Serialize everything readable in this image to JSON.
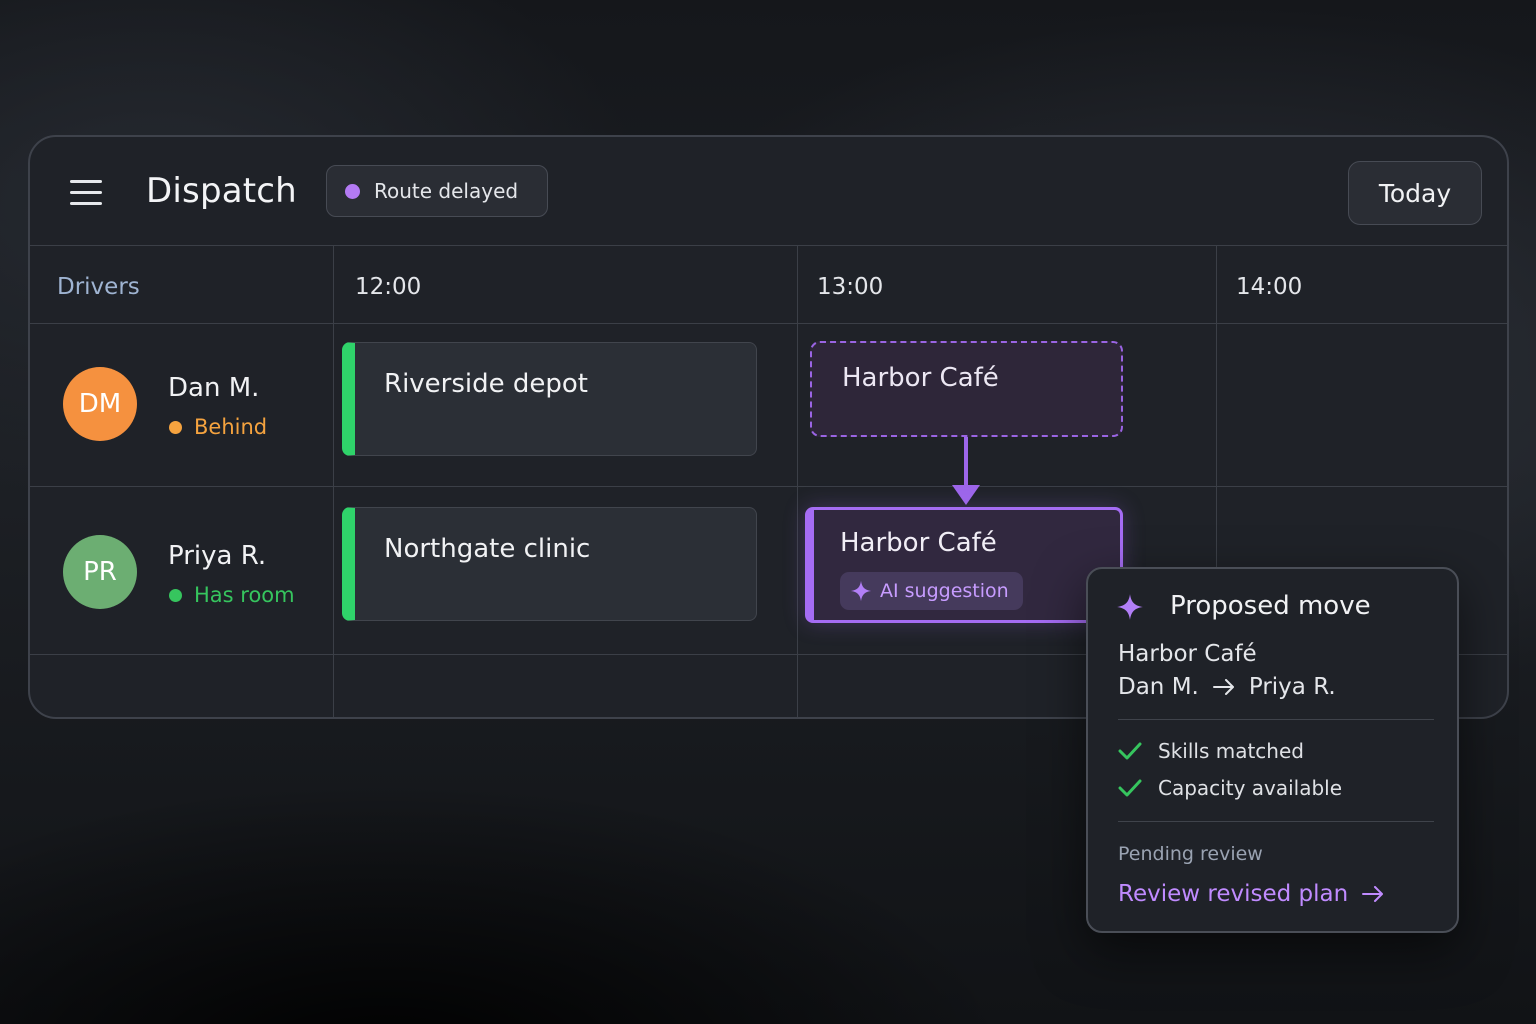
{
  "header": {
    "title": "Dispatch",
    "status_chip": {
      "label": "Route delayed",
      "color": "#b37af3"
    },
    "today_label": "Today"
  },
  "grid": {
    "columns": [
      "Drivers",
      "12:00",
      "13:00",
      "14:00"
    ]
  },
  "drivers": [
    {
      "initials": "DM",
      "name": "Dan M.",
      "status": "Behind",
      "avatar_color": "#f5913f",
      "status_color": "#f5a33f"
    },
    {
      "initials": "PR",
      "name": "Priya R.",
      "status": "Has room",
      "avatar_color": "#6cae72",
      "status_color": "#36c55e"
    }
  ],
  "jobs": {
    "dan_noon": "Riverside depot",
    "priya_noon": "Northgate clinic",
    "dan_ghost": "Harbor Café",
    "priya_new": "Harbor Café",
    "ai_badge": "AI suggestion"
  },
  "popover": {
    "title": "Proposed move",
    "job": "Harbor Café",
    "from": "Dan M.",
    "to": "Priya R.",
    "checks": [
      "Skills matched",
      "Capacity available"
    ],
    "pending": "Pending review",
    "review_link": "Review revised plan"
  },
  "colors": {
    "accent": "#a56cf4",
    "job_bar": "#2fd36a",
    "check": "#36c55e"
  }
}
